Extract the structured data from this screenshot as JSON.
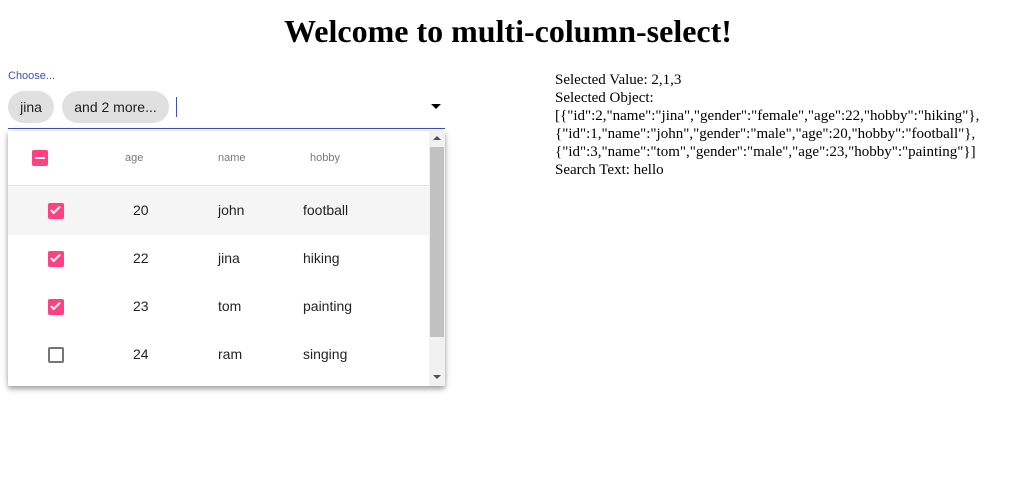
{
  "page": {
    "title": "Welcome to multi-column-select!"
  },
  "select": {
    "label": "Choose...",
    "chips": [
      "jina",
      "and 2 more..."
    ],
    "search_value": "",
    "header": {
      "col_age": "age",
      "col_name": "name",
      "col_hobby": "hobby"
    },
    "rows": [
      {
        "age": "20",
        "name": "john",
        "hobby": "football",
        "checked": true
      },
      {
        "age": "22",
        "name": "jina",
        "hobby": "hiking",
        "checked": true
      },
      {
        "age": "23",
        "name": "tom",
        "hobby": "painting",
        "checked": true
      },
      {
        "age": "24",
        "name": "ram",
        "hobby": "singing",
        "checked": false
      }
    ]
  },
  "info": {
    "selected_value": "Selected Value: 2,1,3",
    "selected_object_label": "Selected Object:",
    "selected_object_lines": [
      "[{\"id\":2,\"name\":\"jina\",\"gender\":\"female\",\"age\":22,\"hobby\":\"hiking\"},",
      "{\"id\":1,\"name\":\"john\",\"gender\":\"male\",\"age\":20,\"hobby\":\"football\"},",
      "{\"id\":3,\"name\":\"tom\",\"gender\":\"male\",\"age\":23,\"hobby\":\"painting\"}]"
    ],
    "search_text": "Search Text: hello"
  },
  "colors": {
    "accent": "#ff4081",
    "primary": "#3f51b5"
  }
}
